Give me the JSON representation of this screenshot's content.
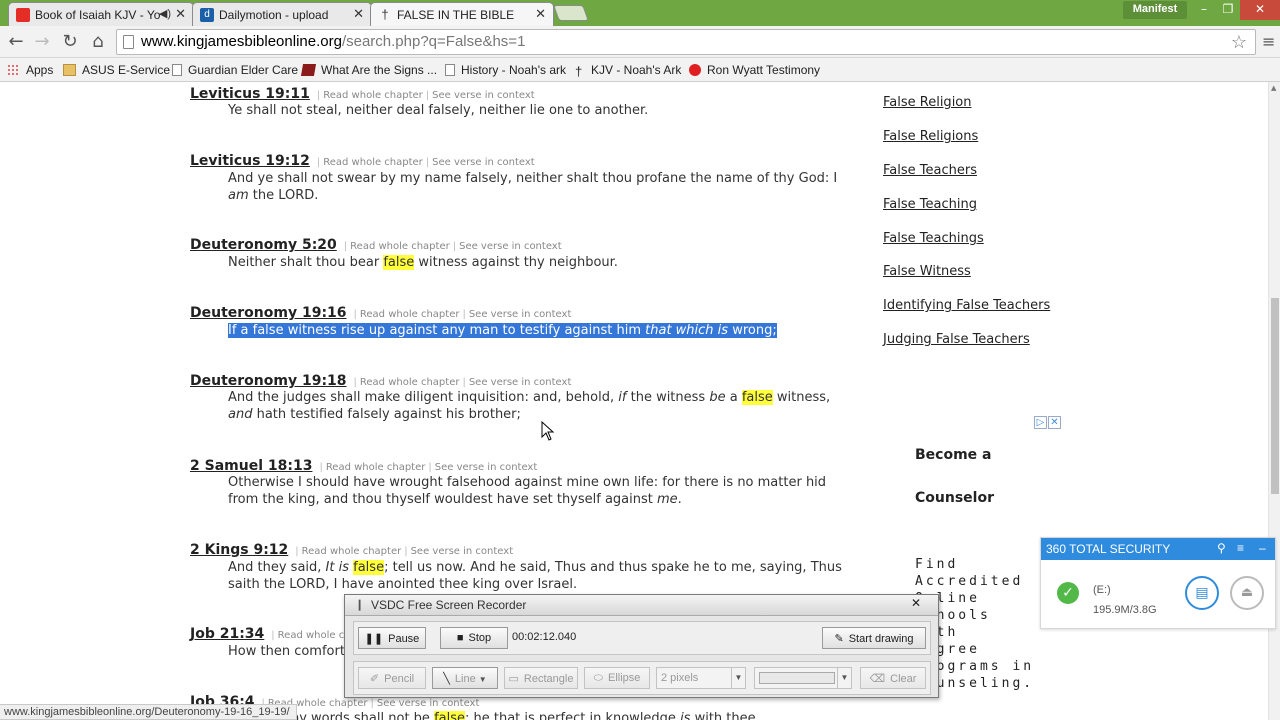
{
  "browser": {
    "tabs": [
      {
        "title": "Book of Isaiah KJV - Yo",
        "icon": "youtube-icon",
        "active": false
      },
      {
        "title": "Dailymotion - upload",
        "icon": "dailymotion-icon",
        "active": false
      },
      {
        "title": "FALSE IN THE BIBLE",
        "icon": "cross-icon",
        "active": true
      }
    ],
    "profile_label": "Manifest",
    "url_domain": "www.kingjamesbibleonline.org",
    "url_path": "/search.php?q=False&hs=1",
    "bookmarks": [
      {
        "label": "Apps",
        "icon": "apps-grid-icon"
      },
      {
        "label": "ASUS E-Service",
        "icon": "folder-icon"
      },
      {
        "label": "Guardian Elder Care",
        "icon": "page-icon"
      },
      {
        "label": "What Are the Signs ...",
        "icon": "video-icon"
      },
      {
        "label": "History - Noah's ark",
        "icon": "page-icon"
      },
      {
        "label": "KJV - Noah's Ark",
        "icon": "cross-icon"
      },
      {
        "label": "Ron Wyatt Testimony",
        "icon": "red-circle-icon"
      }
    ],
    "status_url": "www.kingjamesbibleonline.org/Deuteronomy-19-16_19-19/"
  },
  "verse_links": {
    "read": "Read whole chapter",
    "see": "See verse in context",
    "sep": "|"
  },
  "verses": {
    "lev1911": {
      "ref": "Leviticus 19:11",
      "text": "Ye shall not steal, neither deal falsely, neither lie one to another."
    },
    "lev1912": {
      "ref": "Leviticus 19:12",
      "t1": "And ye shall not swear by my name falsely, neither shalt thou profane the name of thy God: I",
      "t2": "am",
      "t3": " the LORD."
    },
    "deu520": {
      "ref": "Deuteronomy 5:20",
      "t1": "Neither shalt thou bear ",
      "hl": "false",
      "t2": " witness against thy neighbour."
    },
    "deu1916": {
      "ref": "Deuteronomy 19:16",
      "t1": "If a false witness rise up against any man to testify against him ",
      "it": "that which is",
      "t2": " wrong;"
    },
    "deu1918": {
      "ref": "Deuteronomy 19:18",
      "t1": "And the judges shall make diligent inquisition: and, behold, ",
      "i1": "if",
      "t2": " the witness ",
      "i2": "be",
      "t3": " a ",
      "hl": "false",
      "t4": " witness,",
      "i3": "and",
      "t5": " hath testified falsely against his brother;"
    },
    "sam1813": {
      "ref": "2 Samuel 18:13",
      "t1": "Otherwise I should have wrought falsehood against mine own life: for there is no matter hid from the king, and thou thyself wouldest have set thyself against ",
      "i1": "me",
      "t2": "."
    },
    "kgs912": {
      "ref": "2 Kings 9:12",
      "t1": "And they said, ",
      "i1": "It is",
      "t2": " ",
      "hl": "false",
      "t3": "; tell us now. And he said, Thus and thus spake he to me, saying, Thus saith the LORD, I have anointed thee king over Israel."
    },
    "job2134": {
      "ref": "Job 21:34",
      "t1": "How then comfort"
    },
    "job364": {
      "ref": "Job 36:4",
      "t1": "For truly my words shall not be ",
      "hl": "false",
      "t2": ": he that is perfect in knowledge ",
      "i1": "is",
      "t3": " with thee."
    }
  },
  "sidebar_links": [
    "False Religion",
    "False Religions",
    "False Teachers",
    "False Teaching",
    "False Teachings",
    "False Witness",
    "Identifying False Teachers",
    "Judging False Teachers"
  ],
  "ad": {
    "title1": "Become a",
    "title2": "Counselor",
    "body": [
      "Find",
      "Accredited",
      "Online",
      "Schools",
      "With",
      "Degree",
      "Programs in",
      "Counseling."
    ]
  },
  "security": {
    "title": "360 TOTAL SECURITY",
    "drive": "(E:)",
    "usage": "195.9M/3.8G",
    "accent": "#2f8bde"
  },
  "recorder": {
    "title": "VSDC Free Screen Recorder",
    "pause": "Pause",
    "stop": "Stop",
    "time": "00:02:12.040",
    "start_drawing": "Start drawing",
    "tools": {
      "pencil": "Pencil",
      "line": "Line",
      "rectangle": "Rectangle",
      "ellipse": "Ellipse",
      "thickness": "2 pixels",
      "clear": "Clear"
    }
  }
}
